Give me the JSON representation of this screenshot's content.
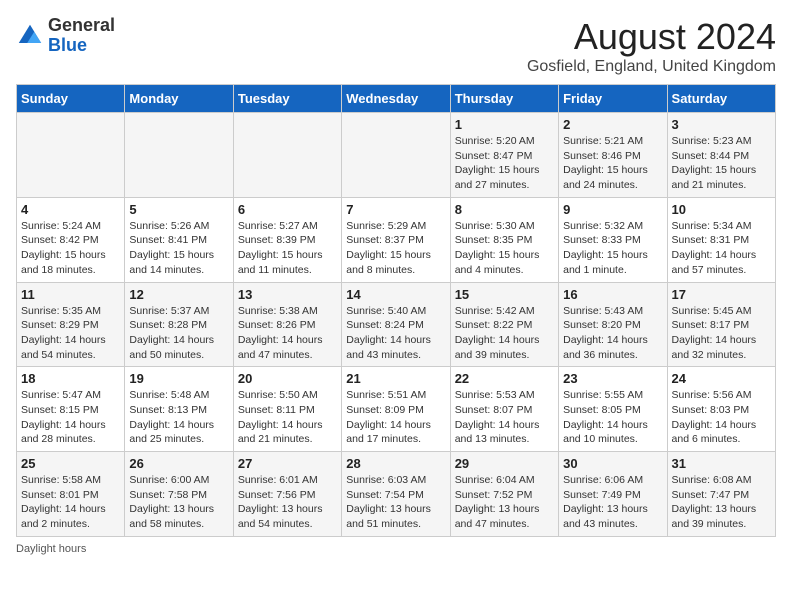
{
  "logo": {
    "general": "General",
    "blue": "Blue"
  },
  "header": {
    "month_year": "August 2024",
    "location": "Gosfield, England, United Kingdom"
  },
  "days_of_week": [
    "Sunday",
    "Monday",
    "Tuesday",
    "Wednesday",
    "Thursday",
    "Friday",
    "Saturday"
  ],
  "weeks": [
    [
      {
        "day": "",
        "info": ""
      },
      {
        "day": "",
        "info": ""
      },
      {
        "day": "",
        "info": ""
      },
      {
        "day": "",
        "info": ""
      },
      {
        "day": "1",
        "info": "Sunrise: 5:20 AM\nSunset: 8:47 PM\nDaylight: 15 hours and 27 minutes."
      },
      {
        "day": "2",
        "info": "Sunrise: 5:21 AM\nSunset: 8:46 PM\nDaylight: 15 hours and 24 minutes."
      },
      {
        "day": "3",
        "info": "Sunrise: 5:23 AM\nSunset: 8:44 PM\nDaylight: 15 hours and 21 minutes."
      }
    ],
    [
      {
        "day": "4",
        "info": "Sunrise: 5:24 AM\nSunset: 8:42 PM\nDaylight: 15 hours and 18 minutes."
      },
      {
        "day": "5",
        "info": "Sunrise: 5:26 AM\nSunset: 8:41 PM\nDaylight: 15 hours and 14 minutes."
      },
      {
        "day": "6",
        "info": "Sunrise: 5:27 AM\nSunset: 8:39 PM\nDaylight: 15 hours and 11 minutes."
      },
      {
        "day": "7",
        "info": "Sunrise: 5:29 AM\nSunset: 8:37 PM\nDaylight: 15 hours and 8 minutes."
      },
      {
        "day": "8",
        "info": "Sunrise: 5:30 AM\nSunset: 8:35 PM\nDaylight: 15 hours and 4 minutes."
      },
      {
        "day": "9",
        "info": "Sunrise: 5:32 AM\nSunset: 8:33 PM\nDaylight: 15 hours and 1 minute."
      },
      {
        "day": "10",
        "info": "Sunrise: 5:34 AM\nSunset: 8:31 PM\nDaylight: 14 hours and 57 minutes."
      }
    ],
    [
      {
        "day": "11",
        "info": "Sunrise: 5:35 AM\nSunset: 8:29 PM\nDaylight: 14 hours and 54 minutes."
      },
      {
        "day": "12",
        "info": "Sunrise: 5:37 AM\nSunset: 8:28 PM\nDaylight: 14 hours and 50 minutes."
      },
      {
        "day": "13",
        "info": "Sunrise: 5:38 AM\nSunset: 8:26 PM\nDaylight: 14 hours and 47 minutes."
      },
      {
        "day": "14",
        "info": "Sunrise: 5:40 AM\nSunset: 8:24 PM\nDaylight: 14 hours and 43 minutes."
      },
      {
        "day": "15",
        "info": "Sunrise: 5:42 AM\nSunset: 8:22 PM\nDaylight: 14 hours and 39 minutes."
      },
      {
        "day": "16",
        "info": "Sunrise: 5:43 AM\nSunset: 8:20 PM\nDaylight: 14 hours and 36 minutes."
      },
      {
        "day": "17",
        "info": "Sunrise: 5:45 AM\nSunset: 8:17 PM\nDaylight: 14 hours and 32 minutes."
      }
    ],
    [
      {
        "day": "18",
        "info": "Sunrise: 5:47 AM\nSunset: 8:15 PM\nDaylight: 14 hours and 28 minutes."
      },
      {
        "day": "19",
        "info": "Sunrise: 5:48 AM\nSunset: 8:13 PM\nDaylight: 14 hours and 25 minutes."
      },
      {
        "day": "20",
        "info": "Sunrise: 5:50 AM\nSunset: 8:11 PM\nDaylight: 14 hours and 21 minutes."
      },
      {
        "day": "21",
        "info": "Sunrise: 5:51 AM\nSunset: 8:09 PM\nDaylight: 14 hours and 17 minutes."
      },
      {
        "day": "22",
        "info": "Sunrise: 5:53 AM\nSunset: 8:07 PM\nDaylight: 14 hours and 13 minutes."
      },
      {
        "day": "23",
        "info": "Sunrise: 5:55 AM\nSunset: 8:05 PM\nDaylight: 14 hours and 10 minutes."
      },
      {
        "day": "24",
        "info": "Sunrise: 5:56 AM\nSunset: 8:03 PM\nDaylight: 14 hours and 6 minutes."
      }
    ],
    [
      {
        "day": "25",
        "info": "Sunrise: 5:58 AM\nSunset: 8:01 PM\nDaylight: 14 hours and 2 minutes."
      },
      {
        "day": "26",
        "info": "Sunrise: 6:00 AM\nSunset: 7:58 PM\nDaylight: 13 hours and 58 minutes."
      },
      {
        "day": "27",
        "info": "Sunrise: 6:01 AM\nSunset: 7:56 PM\nDaylight: 13 hours and 54 minutes."
      },
      {
        "day": "28",
        "info": "Sunrise: 6:03 AM\nSunset: 7:54 PM\nDaylight: 13 hours and 51 minutes."
      },
      {
        "day": "29",
        "info": "Sunrise: 6:04 AM\nSunset: 7:52 PM\nDaylight: 13 hours and 47 minutes."
      },
      {
        "day": "30",
        "info": "Sunrise: 6:06 AM\nSunset: 7:49 PM\nDaylight: 13 hours and 43 minutes."
      },
      {
        "day": "31",
        "info": "Sunrise: 6:08 AM\nSunset: 7:47 PM\nDaylight: 13 hours and 39 minutes."
      }
    ]
  ],
  "footer": {
    "note": "Daylight hours"
  }
}
